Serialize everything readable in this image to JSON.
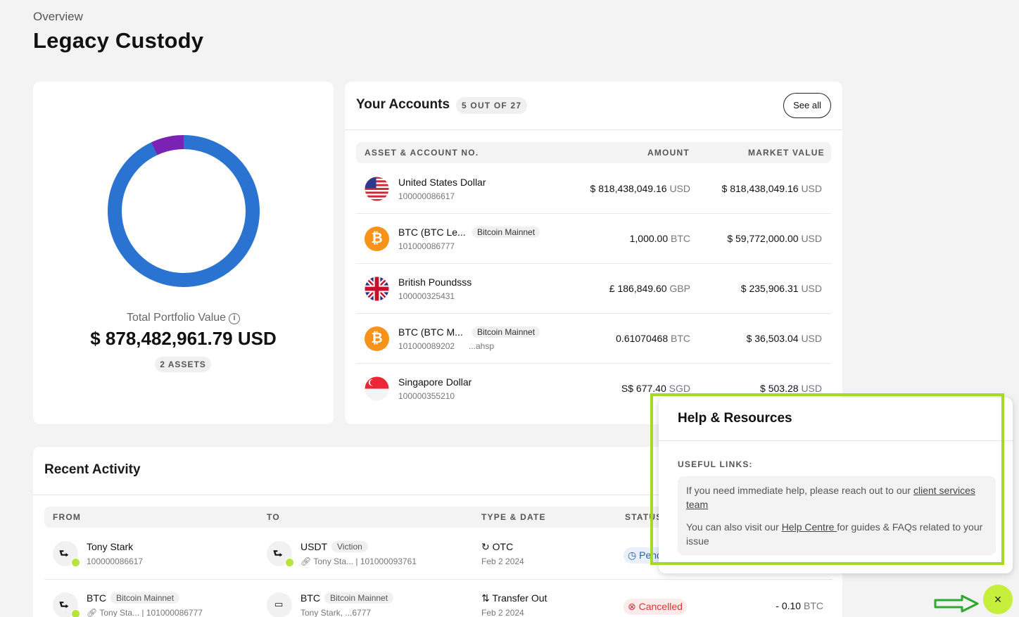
{
  "header": {
    "overline": "Overview",
    "title": "Legacy Custody"
  },
  "portfolio": {
    "total_label": "Total Portfolio Value",
    "total_value": "$ 878,482,961.79 USD",
    "assets_badge": "2 ASSETS",
    "donut_colors": {
      "major": "#2b73d1",
      "minor": "#7a22b4"
    },
    "donut_segments": [
      0.93,
      0.07
    ]
  },
  "accounts": {
    "title": "Your Accounts",
    "count": "5 OUT OF 27",
    "see_all": "See all",
    "columns": {
      "asset": "ASSET & ACCOUNT NO.",
      "amount": "AMOUNT",
      "market_value": "MARKET VALUE"
    },
    "rows": [
      {
        "icon": "us-flag-icon",
        "name": "United States Dollar",
        "number": "100000086617",
        "network": "",
        "address": "",
        "amount": "$ 818,438,049.16",
        "amount_cur": "USD",
        "mv": "$ 818,438,049.16",
        "mv_cur": "USD"
      },
      {
        "icon": "bitcoin-icon",
        "name": "BTC (BTC Le...",
        "number": "101000086777",
        "network": "Bitcoin Mainnet",
        "address": "",
        "amount": "1,000.00",
        "amount_cur": "BTC",
        "mv": "$ 59,772,000.00",
        "mv_cur": "USD"
      },
      {
        "icon": "uk-flag-icon",
        "name": "British Poundsss",
        "number": "100000325431",
        "network": "",
        "address": "",
        "amount": "£ 186,849.60",
        "amount_cur": "GBP",
        "mv": "$ 235,906.31",
        "mv_cur": "USD"
      },
      {
        "icon": "bitcoin-icon",
        "name": "BTC (BTC M...",
        "number": "101000089202",
        "network": "Bitcoin Mainnet",
        "address": "...ahsp",
        "amount": "0.61070468",
        "amount_cur": "BTC",
        "mv": "$ 36,503.04",
        "mv_cur": "USD"
      },
      {
        "icon": "sg-flag-icon",
        "name": "Singapore Dollar",
        "number": "100000355210",
        "network": "",
        "address": "",
        "amount": "S$ 677.40",
        "amount_cur": "SGD",
        "mv": "$ 503.28",
        "mv_cur": "USD"
      }
    ]
  },
  "activity": {
    "title": "Recent Activity",
    "columns": {
      "from": "FROM",
      "to": "TO",
      "type_date": "TYPE & DATE",
      "status": "STATUS"
    },
    "rows": [
      {
        "from_name": "Tony Stark",
        "from_sub": "100000086617",
        "to_name": "USDT",
        "to_network": "Viction",
        "to_sub": "Tony Sta...",
        "to_acc": "101000093761",
        "type": "OTC",
        "date": "Feb 2 2024",
        "status": "Pend",
        "amount": ""
      },
      {
        "from_name": "BTC",
        "from_network": "Bitcoin Mainnet",
        "from_sub": "Tony Sta...",
        "from_acc": "101000086777",
        "to_name": "BTC",
        "to_network": "Bitcoin Mainnet",
        "to_sub": "Tony Stark, ...6777",
        "type": "Transfer Out",
        "date": "Feb 2 2024",
        "status": "Cancelled",
        "amount": "- 0.10",
        "amount_cur": "BTC"
      }
    ]
  },
  "help": {
    "title": "Help & Resources",
    "useful_label": "USEFUL LINKS:",
    "p1_text": "If you need immediate help, please reach out to our ",
    "p1_link": "client services team",
    "p2_text": "You can also visit our ",
    "p2_link": "Help Centre ",
    "p2_suffix": "for guides & FAQs related to your issue",
    "close_label": "×"
  },
  "colors": {
    "accent_green": "#c5ef3a",
    "highlight": "#a6d82a",
    "arrow": "#2fa82f"
  }
}
